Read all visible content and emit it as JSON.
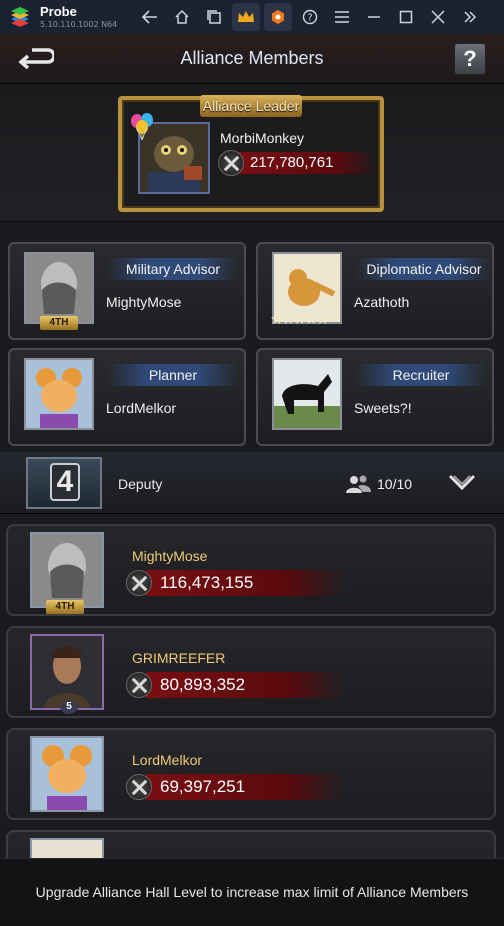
{
  "emulator": {
    "app_name": "Probe",
    "version": "5.10.110.1002 N64",
    "icons": [
      "back-arrow-icon",
      "home-icon",
      "multi-window-icon",
      "crown-icon",
      "hexagon-icon",
      "help-icon",
      "menu-icon",
      "minimize-icon",
      "maximize-icon",
      "close-icon",
      "double-chevron-icon"
    ]
  },
  "header": {
    "title": "Alliance Members",
    "help": "?"
  },
  "leader": {
    "banner": "Alliance Leader",
    "name": "MorbiMonkey",
    "power": "217,780,761"
  },
  "officers": [
    {
      "role": "Military Advisor",
      "name": "MightyMose",
      "badge": "4TH"
    },
    {
      "role": "Diplomatic Advisor",
      "name": "Azathoth",
      "stars": "★★★★★"
    },
    {
      "role": "Planner",
      "name": "LordMelkor"
    },
    {
      "role": "Recruiter",
      "name": "Sweets?!"
    }
  ],
  "deputy": {
    "rank": "4",
    "label": "Deputy",
    "count": "10/10"
  },
  "members": [
    {
      "name": "MightyMose",
      "power": "116,473,155",
      "badge": "4TH"
    },
    {
      "name": "GRIMREEFER",
      "power": "80,893,352",
      "badge": "5"
    },
    {
      "name": "LordMelkor",
      "power": "69,397,251"
    }
  ],
  "notice": "Upgrade Alliance Hall Level to increase max limit of Alliance Members",
  "colors": {
    "accent_gold": "#b8923c",
    "power_red": "#7a0e12",
    "role_blue": "#2f4a78",
    "name_gold": "#f1c978"
  }
}
